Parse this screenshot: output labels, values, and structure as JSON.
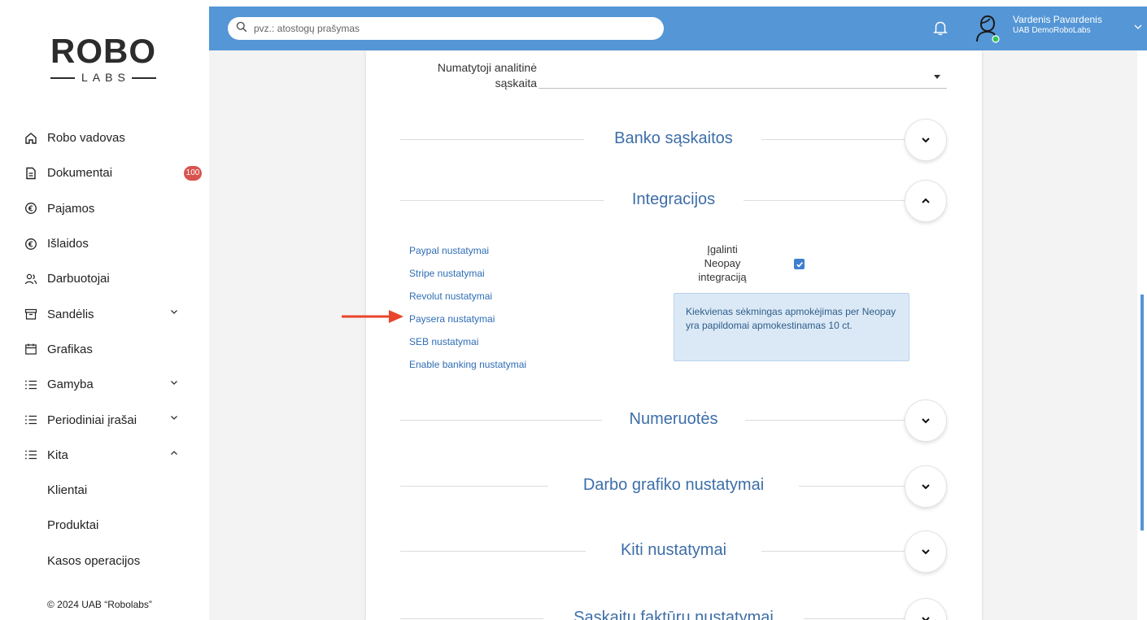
{
  "sidebar": {
    "logo_text": "ROBO",
    "logo_sub": "LABS",
    "items": [
      {
        "label": "Robo vadovas"
      },
      {
        "label": "Dokumentai",
        "badge": "100"
      },
      {
        "label": "Pajamos"
      },
      {
        "label": "Išlaidos"
      },
      {
        "label": "Darbuotojai"
      },
      {
        "label": "Sandėlis"
      },
      {
        "label": "Grafikas"
      },
      {
        "label": "Gamyba"
      },
      {
        "label": "Periodiniai įrašai"
      },
      {
        "label": "Kita"
      }
    ],
    "subitems": [
      {
        "label": "Klientai"
      },
      {
        "label": "Produktai"
      },
      {
        "label": "Kasos operacijos"
      }
    ],
    "copyright": "© 2024 UAB “Robolabs”"
  },
  "header": {
    "search_placeholder": "pvz.: atostogų prašymas",
    "user_name": "Vardenis Pavardenis",
    "user_company": "UAB DemoRoboLabs"
  },
  "main": {
    "analytic_account_label_line1": "Numatytoji analitinė",
    "analytic_account_label_line2": "sąskaita",
    "sections": {
      "bank": "Banko sąskaitos",
      "integrations": "Integracijos",
      "numbering": "Numeruotės",
      "schedule": "Darbo grafiko nustatymai",
      "other": "Kiti nustatymai",
      "invoices": "Sąskaitų faktūrų nustatymai"
    },
    "integration_links": [
      "Paypal nustatymai",
      "Stripe nustatymai",
      "Revolut nustatymai",
      "Paysera nustatymai",
      "SEB nustatymai",
      "Enable banking nustatymai"
    ],
    "neopay_label_line1": "Įgalinti",
    "neopay_label_line2": "Neopay",
    "neopay_label_line3": "integraciją",
    "neopay_enabled": true,
    "neopay_info": "Kiekvienas sėkmingas apmokėjimas per Neopay yra papildomai apmokestinamas 10 ct."
  },
  "colors": {
    "header_bg": "#5496d6",
    "accent_text": "#3d6ea8",
    "link": "#2f6db5",
    "badge": "#d9534f",
    "annotation_arrow": "#e8452c"
  }
}
